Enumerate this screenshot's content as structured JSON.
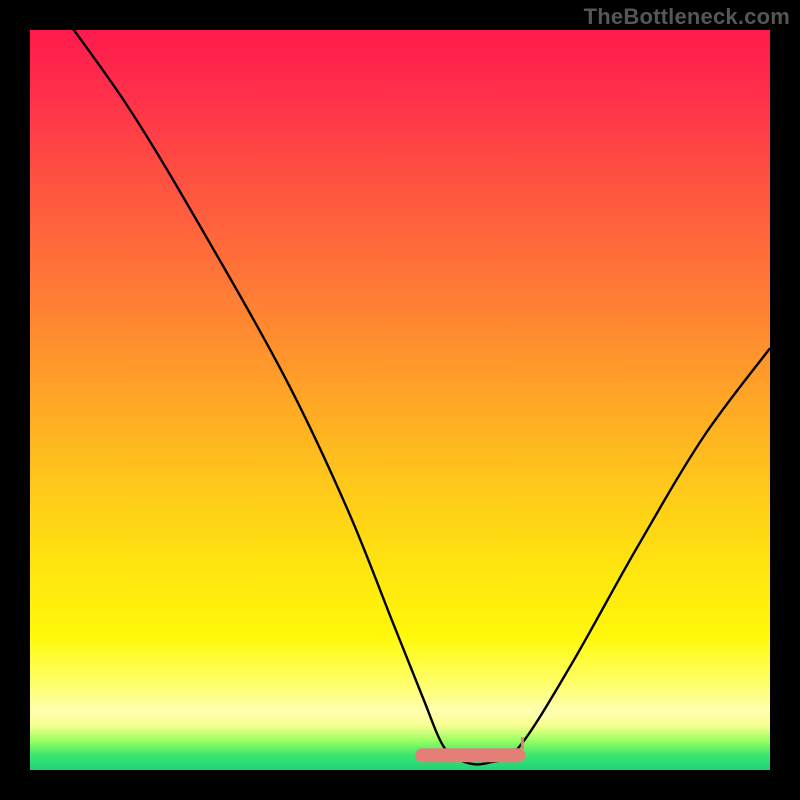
{
  "watermark": "TheBottleneck.com",
  "chart_data": {
    "type": "line",
    "title": "",
    "xlabel": "",
    "ylabel": "",
    "xlim": [
      0,
      100
    ],
    "ylim": [
      0,
      100
    ],
    "series": [
      {
        "name": "bottleneck-curve",
        "x": [
          0,
          13,
          25,
          35,
          43,
          49,
          53,
          56,
          59,
          62,
          66,
          73,
          82,
          91,
          100
        ],
        "values": [
          108,
          90,
          70,
          52,
          35,
          20,
          10,
          3,
          1,
          1,
          3,
          14,
          30,
          45,
          57
        ]
      }
    ],
    "highlight_region": {
      "name": "optimal-range",
      "x_start": 53,
      "x_end": 66,
      "y": 2
    },
    "background_gradient": {
      "stops": [
        {
          "pos": 0.0,
          "color": "#ff1a4d"
        },
        {
          "pos": 0.5,
          "color": "#ffb022"
        },
        {
          "pos": 0.85,
          "color": "#fff90a"
        },
        {
          "pos": 1.0,
          "color": "#22d07a"
        }
      ]
    }
  }
}
